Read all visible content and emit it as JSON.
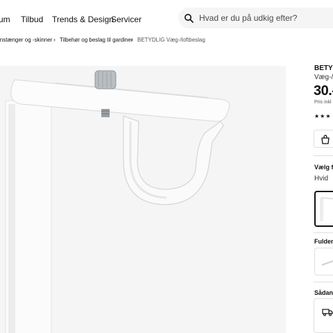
{
  "nav": {
    "items": [
      {
        "label": "um"
      },
      {
        "label": "Tilbud"
      },
      {
        "label": "Trends & Design"
      },
      {
        "label": "Servicer"
      }
    ]
  },
  "search": {
    "placeholder": "Hvad er du på udkig efter?"
  },
  "breadcrumb": {
    "items": [
      {
        "label": "instænger og -skinner"
      },
      {
        "label": "Tilbehør og beslag til gardiner"
      },
      {
        "label": "BETYDLIG Væg-/loftbeslag"
      }
    ],
    "separator": "›"
  },
  "product": {
    "name": "BETYD",
    "subtitle": "Væg-/",
    "price": "30.-",
    "price_note": "Pris inkl",
    "rating_stars": "★★★"
  },
  "color_section": {
    "label": "Vælg fa",
    "value": "Hvid"
  },
  "size_section": {
    "label": "Fulden"
  },
  "delivery_section": {
    "label": "Sådan"
  },
  "icons": {
    "search": "search-icon",
    "favourite": "shopping-bag-icon",
    "delivery": "truck-icon"
  },
  "colors": {
    "accent": "#111111",
    "panel": "#f5f5f5",
    "search_bg": "#f5f5f5"
  }
}
